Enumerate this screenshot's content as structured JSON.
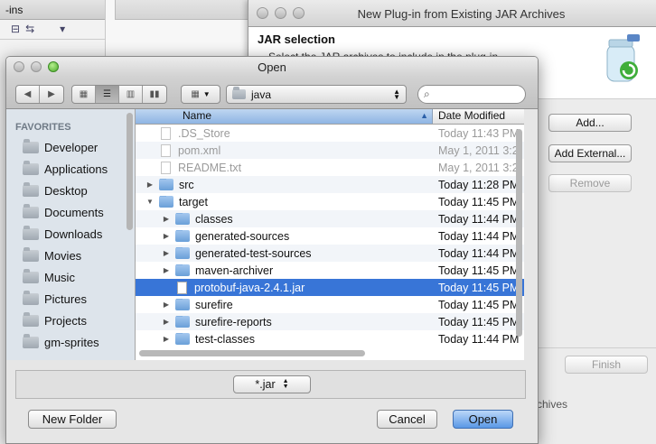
{
  "background": {
    "panel_tab": "-ins",
    "wizard": {
      "title": "New Plug-in from Existing JAR Archives",
      "heading": "JAR selection",
      "description": "Select the JAR archives to include in the plug-in",
      "buttons": {
        "add": "Add...",
        "add_external": "Add External...",
        "remove": "Remove",
        "finish": "Finish"
      },
      "fragment_text": "rchives"
    }
  },
  "dialog": {
    "title": "Open",
    "location": "java",
    "search_placeholder": "",
    "sidebar": {
      "section": "FAVORITES",
      "items": [
        {
          "label": "Developer",
          "icon": "folder-icon"
        },
        {
          "label": "Applications",
          "icon": "applications-icon"
        },
        {
          "label": "Desktop",
          "icon": "desktop-icon"
        },
        {
          "label": "Documents",
          "icon": "documents-icon"
        },
        {
          "label": "Downloads",
          "icon": "downloads-icon"
        },
        {
          "label": "Movies",
          "icon": "movies-icon"
        },
        {
          "label": "Music",
          "icon": "music-icon"
        },
        {
          "label": "Pictures",
          "icon": "pictures-icon"
        },
        {
          "label": "Projects",
          "icon": "folder-icon"
        },
        {
          "label": "gm-sprites",
          "icon": "folder-icon"
        }
      ]
    },
    "columns": {
      "name": "Name",
      "date": "Date Modified"
    },
    "files": [
      {
        "name": ".DS_Store",
        "date": "Today 11:43 PM",
        "kind": "file",
        "level": 0,
        "expand": "",
        "dim": true
      },
      {
        "name": "pom.xml",
        "date": "May 1, 2011 3:2",
        "kind": "xml",
        "level": 0,
        "expand": "",
        "dim": true
      },
      {
        "name": "README.txt",
        "date": "May 1, 2011 3:2",
        "kind": "file",
        "level": 0,
        "expand": "",
        "dim": true
      },
      {
        "name": "src",
        "date": "Today 11:28 PM",
        "kind": "folder",
        "level": 0,
        "expand": "closed"
      },
      {
        "name": "target",
        "date": "Today 11:45 PM",
        "kind": "folder",
        "level": 0,
        "expand": "open"
      },
      {
        "name": "classes",
        "date": "Today 11:44 PM",
        "kind": "folder",
        "level": 1,
        "expand": "closed"
      },
      {
        "name": "generated-sources",
        "date": "Today 11:44 PM",
        "kind": "folder",
        "level": 1,
        "expand": "closed"
      },
      {
        "name": "generated-test-sources",
        "date": "Today 11:44 PM",
        "kind": "folder",
        "level": 1,
        "expand": "closed"
      },
      {
        "name": "maven-archiver",
        "date": "Today 11:45 PM",
        "kind": "folder",
        "level": 1,
        "expand": "closed"
      },
      {
        "name": "protobuf-java-2.4.1.jar",
        "date": "Today 11:45 PM",
        "kind": "jar",
        "level": 1,
        "expand": "",
        "selected": true
      },
      {
        "name": "surefire",
        "date": "Today 11:45 PM",
        "kind": "folder",
        "level": 1,
        "expand": "closed"
      },
      {
        "name": "surefire-reports",
        "date": "Today 11:45 PM",
        "kind": "folder",
        "level": 1,
        "expand": "closed"
      },
      {
        "name": "test-classes",
        "date": "Today 11:44 PM",
        "kind": "folder",
        "level": 1,
        "expand": "closed"
      }
    ],
    "filter": "*.jar",
    "buttons": {
      "new_folder": "New Folder",
      "cancel": "Cancel",
      "open": "Open"
    }
  }
}
